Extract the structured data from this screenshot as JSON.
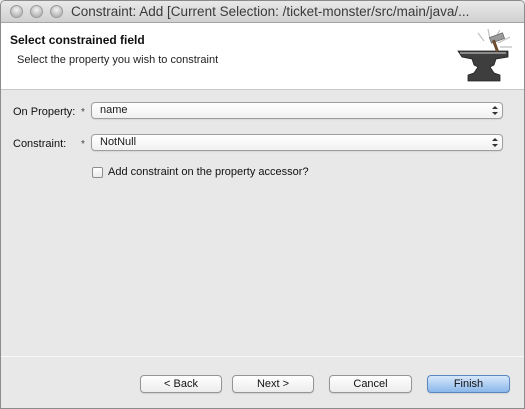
{
  "window": {
    "title": "Constraint: Add [Current Selection: /ticket-monster/src/main/java/..."
  },
  "banner": {
    "title": "Select constrained field",
    "description": "Select the property you wish to constraint",
    "icon": "anvil-icon"
  },
  "form": {
    "on_property_label": "On Property:",
    "on_property_value": "name",
    "constraint_label": "Constraint:",
    "constraint_value": "NotNull",
    "required_marker": "*",
    "accessor_checkbox_label": "Add constraint on the property accessor?",
    "accessor_checked": false
  },
  "buttons": {
    "back": "< Back",
    "next": "Next >",
    "cancel": "Cancel",
    "finish": "Finish"
  },
  "colors": {
    "primary_button": "#8bb7ea",
    "banner_bg": "#ffffff",
    "dialog_bg": "#e8e8e8"
  }
}
